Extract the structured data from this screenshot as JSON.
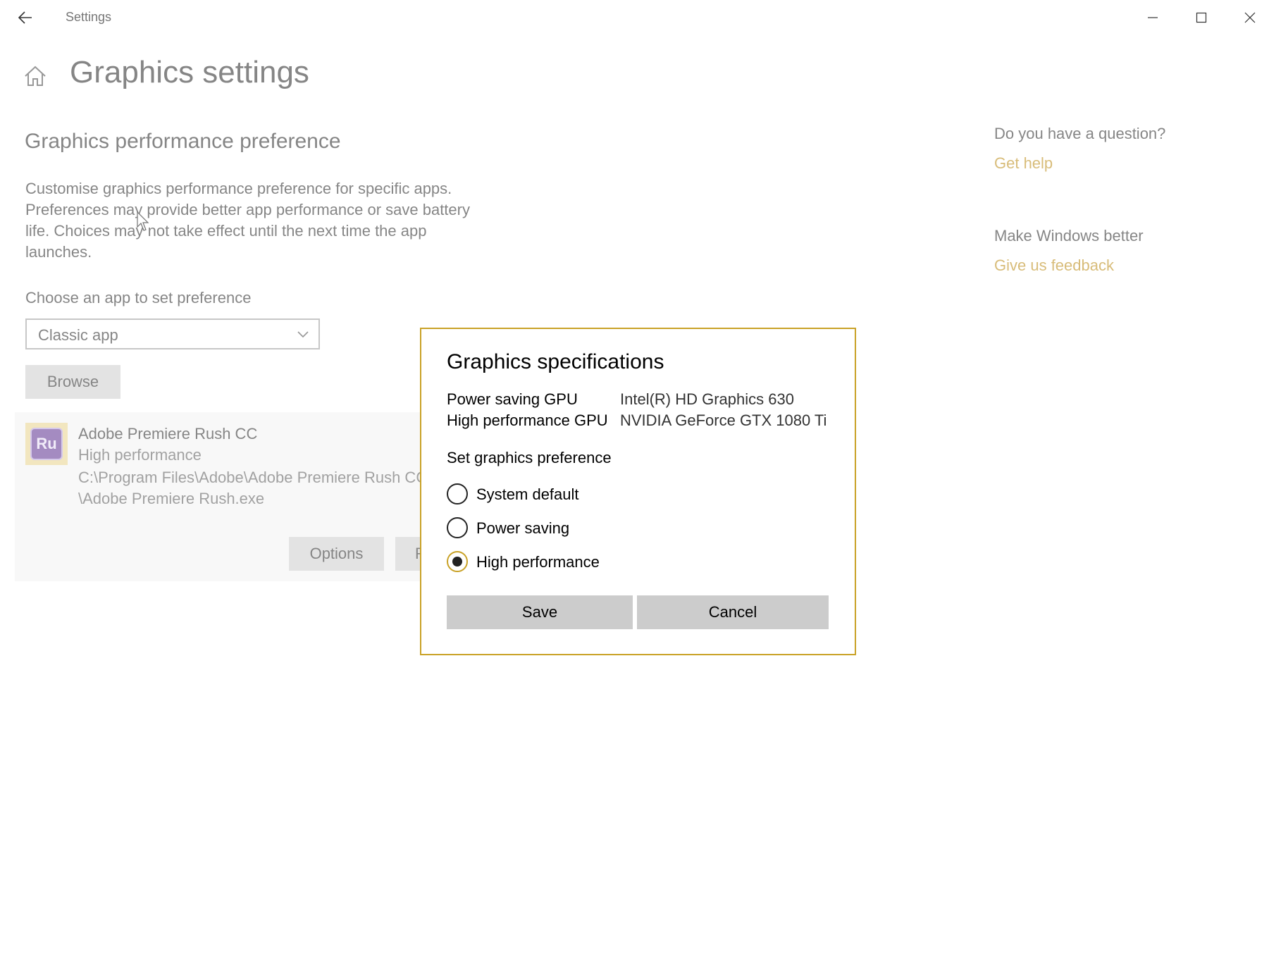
{
  "window": {
    "title": "Settings"
  },
  "page": {
    "title": "Graphics settings",
    "section_title": "Graphics performance preference",
    "description": "Customise graphics performance preference for specific apps. Preferences may provide better app performance or save battery life. Choices may not take effect until the next time the app launches.",
    "choose_label": "Choose an app to set preference",
    "dropdown_value": "Classic app",
    "browse_label": "Browse",
    "app": {
      "name": "Adobe Premiere Rush CC",
      "preference": "High performance",
      "path_line1": "C:\\Program Files\\Adobe\\Adobe Premiere Rush CC",
      "path_line2": "\\Adobe Premiere Rush.exe",
      "icon_text": "Ru",
      "options_label": "Options",
      "remove_label": "R"
    }
  },
  "help": {
    "question": "Do you have a question?",
    "get_help": "Get help",
    "better": "Make Windows better",
    "feedback": "Give us feedback"
  },
  "dialog": {
    "title": "Graphics specifications",
    "specs": [
      {
        "label": "Power saving GPU",
        "value": "Intel(R) HD Graphics 630"
      },
      {
        "label": "High performance GPU",
        "value": "NVIDIA GeForce GTX 1080 Ti"
      }
    ],
    "set_pref_label": "Set graphics preference",
    "options": [
      {
        "label": "System default",
        "selected": false
      },
      {
        "label": "Power saving",
        "selected": false
      },
      {
        "label": "High performance",
        "selected": true
      }
    ],
    "save_label": "Save",
    "cancel_label": "Cancel"
  },
  "colors": {
    "accent": "#c9a227",
    "link": "#b8860b"
  }
}
